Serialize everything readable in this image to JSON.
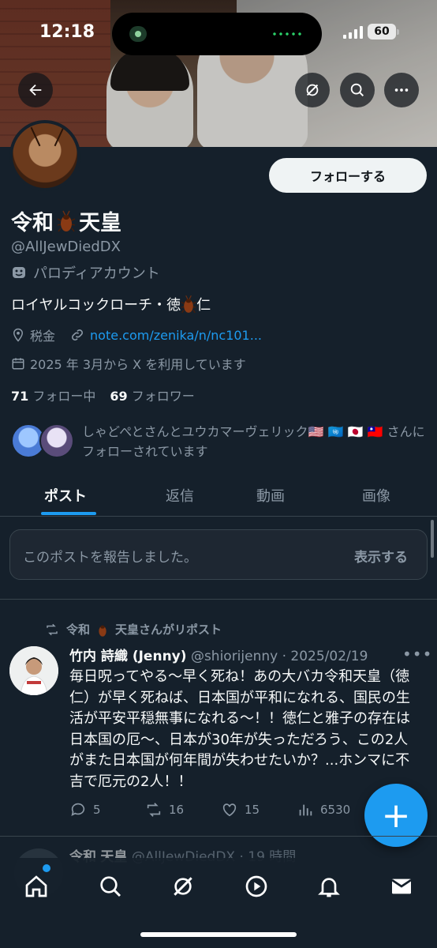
{
  "status_bar": {
    "time": "12:18",
    "battery": "60"
  },
  "profile": {
    "follow_label": "フォローする",
    "name_part1": "令和",
    "name_part2": "天皇",
    "handle": "@AllJewDiedDX",
    "parody_label": "パロディアカウント",
    "bio_part1": "ロイヤルコックローチ・徳",
    "bio_part2": "仁",
    "location": "税金",
    "link": "note.com/zenika/n/nc101...",
    "joined": "2025 年 3月から X を利用しています",
    "following_count": "71",
    "following_label": "フォロー中",
    "followers_count": "69",
    "followers_label": "フォロワー",
    "followed_by": "しゃどぺとさんとユウカマーヴェリック🇺🇸 🇺🇳 🇯🇵 🇹🇼 さんにフォローされています"
  },
  "tabs": [
    {
      "label": "ポスト",
      "active": true
    },
    {
      "label": "返信",
      "active": false
    },
    {
      "label": "動画",
      "active": false
    },
    {
      "label": "画像",
      "active": false
    }
  ],
  "reported": {
    "message": "このポストを報告しました。",
    "show_label": "表示する"
  },
  "post": {
    "repost_by_part1": "令和",
    "repost_by_part2": "天皇さんがリポスト",
    "author_name": "竹内 詩織 (Jenny)",
    "author_meta": "@shiorijenny · 2025/02/19",
    "text": "毎日呪ってやる〜早く死ね！あの大バカ令和天皇（徳仁）が早く死ねば、日本国が平和になれる、国民の生活が平安平穏無事になれる〜！！徳仁と雅子の存在は日本国の厄〜、日本が30年が失っただろう、この2人がまた日本国が何年間が失わせたいか？...ホンマに不吉で厄元の2人！！",
    "replies": "5",
    "reposts": "16",
    "likes": "15",
    "views": "6530"
  },
  "next_post": {
    "name_part1": "令和",
    "name_part2": "天皇",
    "meta": "@AllJewDiedDX · 19 時間"
  },
  "fab_label": "+",
  "colors": {
    "background": "#15202b",
    "accent": "#1d9bf0",
    "text": "#f7f9f9",
    "muted": "#8b98a5",
    "border": "#38444d"
  },
  "icons": [
    "back-arrow-icon",
    "grok-icon",
    "search-icon",
    "more-icon",
    "theater-mask-icon",
    "cockroach-icon",
    "location-icon",
    "link-icon",
    "calendar-icon",
    "repost-icon",
    "reply-icon",
    "like-icon",
    "views-icon",
    "home-icon",
    "explore-icon",
    "video-icon",
    "notifications-icon",
    "messages-icon"
  ]
}
